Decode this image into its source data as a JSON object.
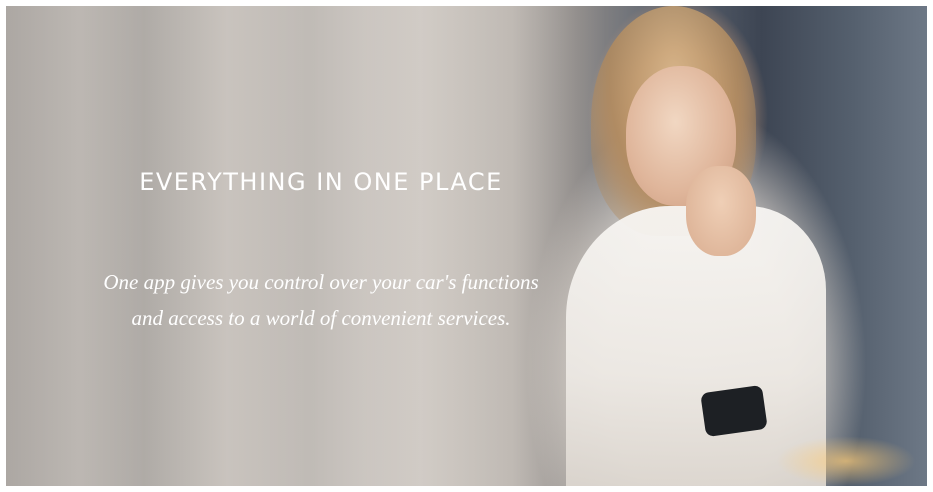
{
  "hero": {
    "heading": "EVERYTHING IN ONE PLACE",
    "tagline_line1": "One app gives you control over your car's functions",
    "tagline_line2": "and access to a world of convenient services."
  },
  "colors": {
    "text": "#ffffff",
    "background_light": "#b6b0aa",
    "background_dark": "#3d4553"
  }
}
